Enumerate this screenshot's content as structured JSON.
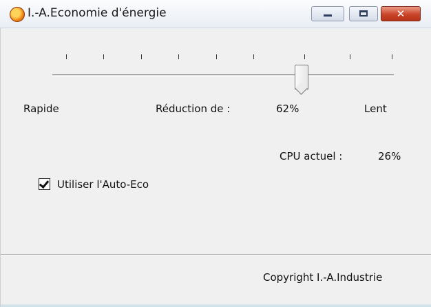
{
  "window": {
    "title": "I.-A.Economie d'énergie",
    "close_label": "✕"
  },
  "slider": {
    "tick_count": 9,
    "value_fraction": 0.73
  },
  "labels": {
    "rapide": "Rapide",
    "reduction_label": "Réduction de :",
    "reduction_value": "62%",
    "lent": "Lent",
    "cpu_label": "CPU actuel :",
    "cpu_value": "26%"
  },
  "autoeco": {
    "label": "Utiliser l'Auto-Eco",
    "checked": true
  },
  "footer": {
    "copyright": "Copyright I.-A.Industrie"
  },
  "colors": {
    "close_button": "#c9452a",
    "window_bg": "#f0f0f0"
  }
}
